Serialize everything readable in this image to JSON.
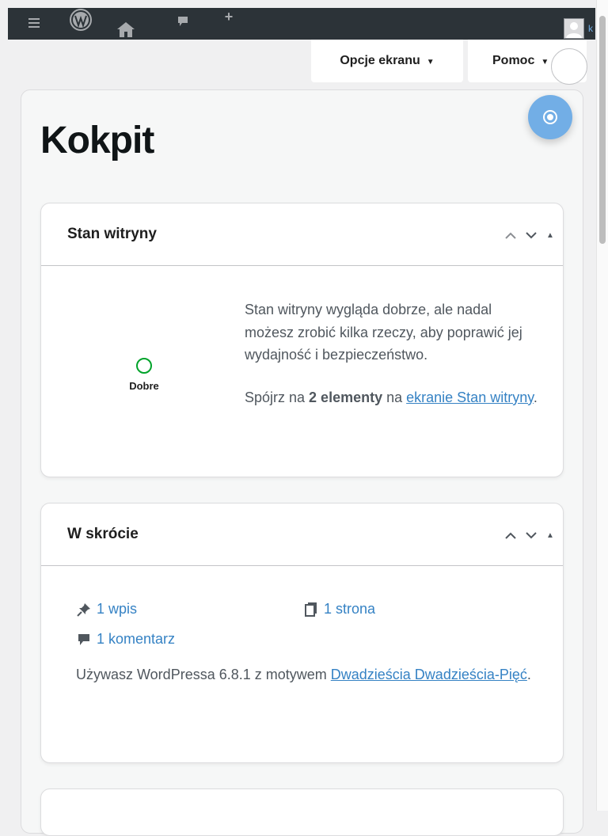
{
  "adminbar": {
    "menu_icon": "hamburger-icon",
    "wp_icon": "wordpress-logo-icon",
    "home_icon": "home-icon",
    "comments_icon": "comment-icon",
    "new_icon": "plus-icon",
    "new_symbol": "+",
    "avatar_icon": "user-avatar-icon",
    "user_fragment": "k"
  },
  "screen_meta": {
    "screen_options_label": "Opcje ekranu",
    "help_label": "Pomoc"
  },
  "page": {
    "title": "Kokpit"
  },
  "widgets": {
    "site_health": {
      "title": "Stan witryny",
      "status_label": "Dobre",
      "message": "Stan witryny wygląda dobrze, ale nadal możesz zrobić kilka rzeczy, aby poprawić jej wydajność i bezpieczeństwo.",
      "items_prefix": "Spójrz na ",
      "items_count": "2 elementy",
      "items_mid": " na ",
      "items_link": "ekranie Stan witryny",
      "items_suffix": "."
    },
    "at_a_glance": {
      "title": "W skrócie",
      "posts": "1 wpis",
      "pages": "1 strona",
      "comments": "1 komentarz",
      "info_prefix": "Używasz WordPressa 6.8.1 z motywem ",
      "theme_link": "Dwadzieścia Dwadzieścia-Pięć",
      "info_suffix": "."
    }
  },
  "colors": {
    "adminbar_bg": "#2c3338",
    "link": "#3582c4",
    "accent_float": "#72aee6",
    "health_good": "#00a32a"
  }
}
